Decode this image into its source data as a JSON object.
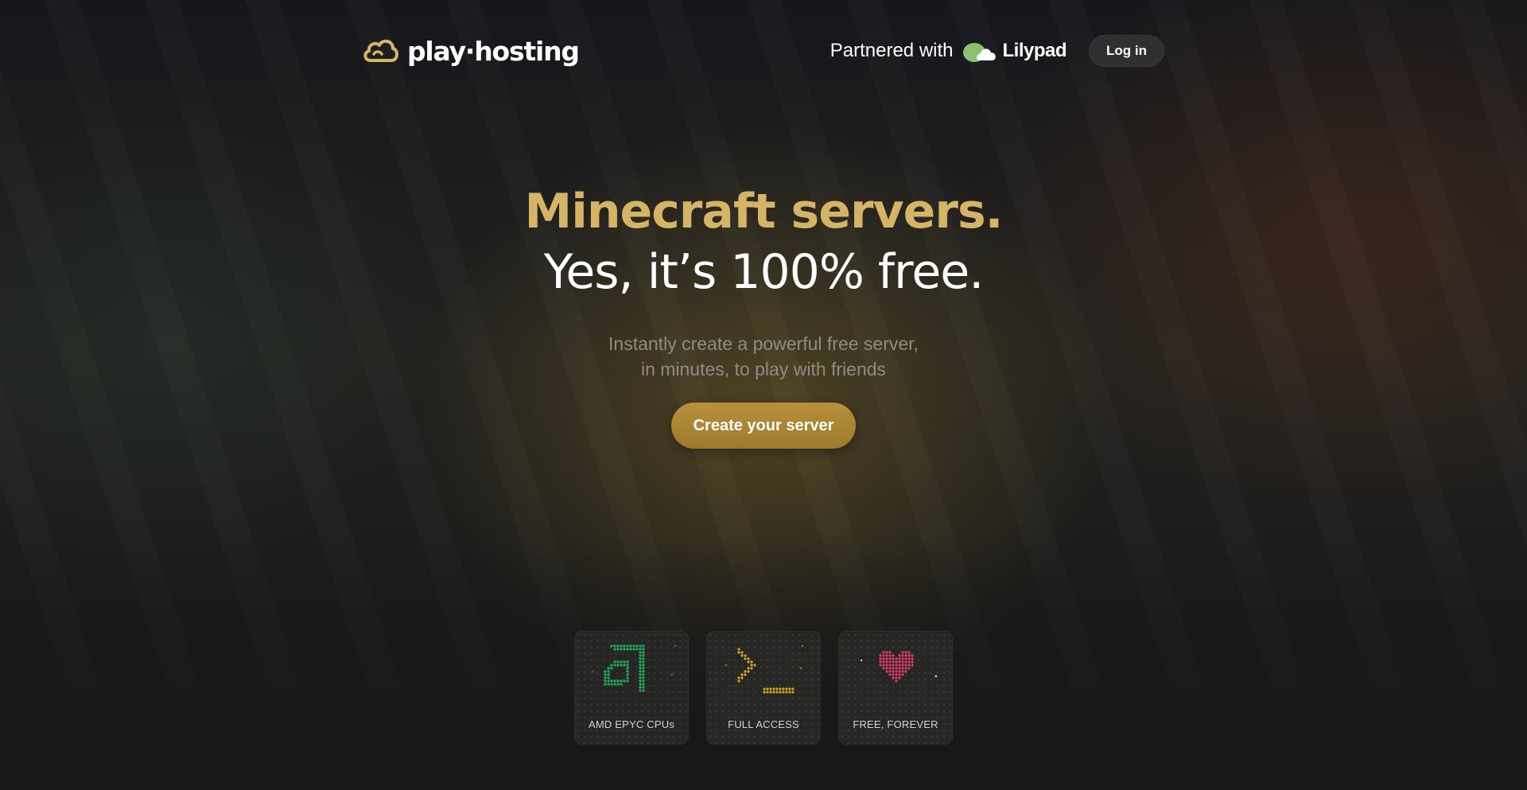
{
  "header": {
    "logo_text": "play·hosting",
    "partner_text": "Partnered with",
    "partner_brand": "Lilypad",
    "login_label": "Log in"
  },
  "hero": {
    "title_line1": "Minecraft servers.",
    "title_line2": "Yes, it’s 100% free.",
    "subtitle_line1": "Instantly create a powerful free server,",
    "subtitle_line2": "in minutes, to play with friends",
    "cta_label": "Create your server"
  },
  "features": [
    {
      "label": "AMD EPYC CPUs",
      "icon": "amd-logo-icon",
      "color": "#1fae5b"
    },
    {
      "label": "FULL ACCESS",
      "icon": "terminal-prompt-icon",
      "color": "#d4a52a"
    },
    {
      "label": "FREE, FOREVER",
      "icon": "heart-icon",
      "color": "#e03a6c"
    }
  ],
  "colors": {
    "accent_gold": "#d6b466",
    "cta_gold": "#b8913b",
    "lilypad_green": "#8cc072"
  }
}
